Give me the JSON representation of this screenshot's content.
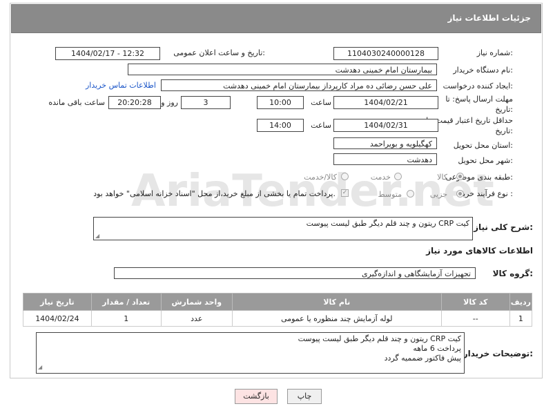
{
  "header": {
    "title": "جزئیات اطلاعات نیاز"
  },
  "fields": {
    "need_number_label": "شماره نیاز:",
    "need_number": "1104030240000128",
    "announce_label": "تاریخ و ساعت اعلان عمومی:",
    "announce_value": "1404/02/17 - 12:32",
    "buyer_org_label": "نام دستگاه خریدار:",
    "buyer_org": "بیمارستان امام خمینی دهدشت",
    "creator_label": "ایجاد کننده درخواست:",
    "creator": "علی حسن رضائی ده مراد کارپرداز بیمارستان امام خمینی دهدشت",
    "contact_link": "اطلاعات تماس خریدار",
    "deadline_label": "مهلت ارسال پاسخ: تا تاریخ:",
    "deadline_date": "1404/02/21",
    "time_label": "ساعت",
    "deadline_time": "10:00",
    "days": "3",
    "days_label": "روز و",
    "remaining": "20:20:28",
    "remaining_label": "ساعت باقی مانده",
    "validity_label": "حداقل تاریخ اعتبار قیمت: تا تاریخ:",
    "validity_date": "1404/02/31",
    "validity_time": "14:00",
    "province_label": "استان محل تحویل:",
    "province": "کهگیلویه و بویراحمد",
    "city_label": "شهر محل تحویل:",
    "city": "دهدشت",
    "category_label": "طبقه بندی موضوعی:",
    "cat_goods": "کالا",
    "cat_service": "خدمت",
    "cat_both": "کالا/خدمت",
    "process_label": "نوع فرآیند خرید :",
    "proc_partial": "جزیی",
    "proc_medium": "متوسط",
    "payment_note": "پرداخت تمام یا بخشی از مبلغ خرید،از محل \"اسناد خزانه اسلامی\" خواهد بود."
  },
  "description": {
    "label": "شرح کلی نیاز:",
    "value": "کیت CRP ریتون و چند قلم دیگر طبق لیست پیوست"
  },
  "goods_section": {
    "title": "اطلاعات کالاهای مورد نیاز",
    "group_label": "گروه کالا:",
    "group_value": "تجهیزات آزمایشگاهی و اندازه‌گیری"
  },
  "table": {
    "headers": [
      "ردیف",
      "کد کالا",
      "نام کالا",
      "واحد شمارش",
      "تعداد / مقدار",
      "تاریخ نیاز"
    ],
    "rows": [
      [
        "1",
        "--",
        "لوله آزمایش چند منظوره یا عمومی",
        "عدد",
        "1",
        "1404/02/24"
      ]
    ]
  },
  "buyer_notes": {
    "label": "توضیحات خریدار:",
    "lines": [
      "کیت CRP ریتون و چند قلم دیگر طبق لیست پیوست",
      "پرداخت 6 ماهه",
      "پیش فاکتور ضممیه گردد"
    ]
  },
  "buttons": {
    "print": "چاپ",
    "back": "بازگشت"
  },
  "watermark": "AriaTender.net"
}
